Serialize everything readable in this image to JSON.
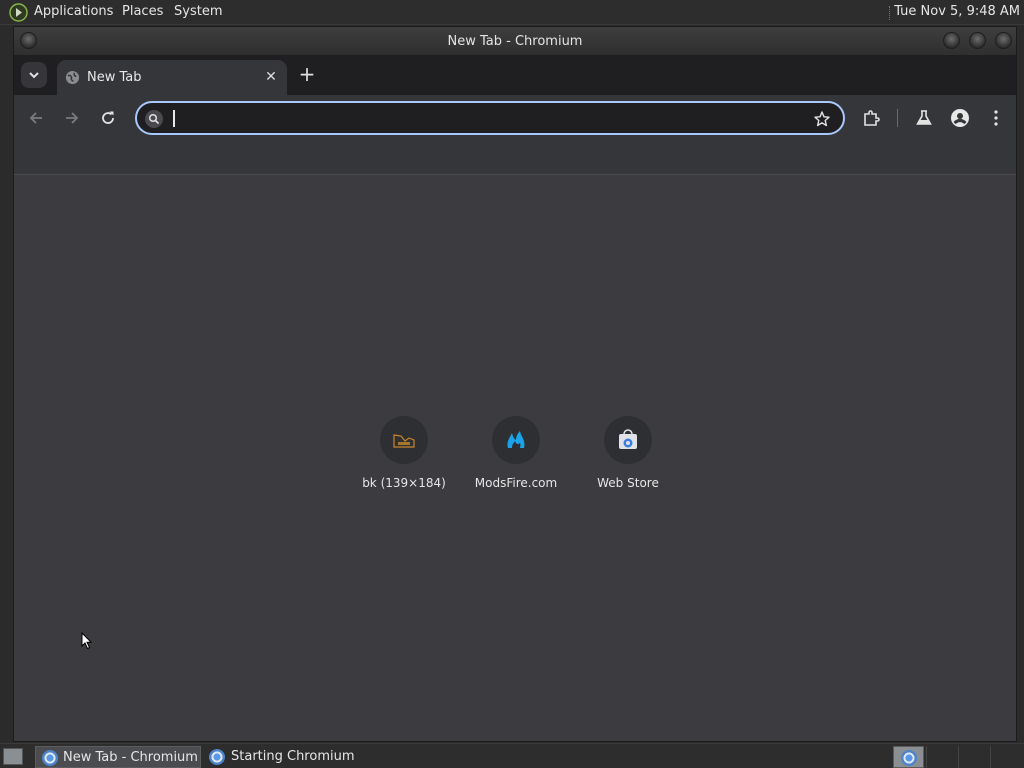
{
  "top_panel": {
    "menus": [
      "Applications",
      "Places",
      "System"
    ],
    "clock": "Tue Nov  5,  9:48 AM"
  },
  "window": {
    "title": "New Tab - Chromium"
  },
  "tabs": [
    {
      "title": "New Tab",
      "active": true
    }
  ],
  "toolbar": {
    "omnibox_value": "",
    "omnibox_placeholder": ""
  },
  "shortcuts": [
    {
      "label": "bk (139×184)",
      "icon": "bk-thumbnail-icon"
    },
    {
      "label": "ModsFire.com",
      "icon": "modsfire-flame-icon"
    },
    {
      "label": "Web Store",
      "icon": "web-store-icon"
    }
  ],
  "taskbar": {
    "tasks": [
      {
        "label": "New Tab - Chromium",
        "active": true
      },
      {
        "label": "Starting Chromium",
        "active": false
      }
    ]
  },
  "colors": {
    "accent_focus_ring": "#a8c7fa",
    "content_background": "#3b3b40",
    "toolbar_background": "#35363a",
    "modsfire_blue": "#1aa3e8",
    "bk_orange": "#c8862a"
  }
}
